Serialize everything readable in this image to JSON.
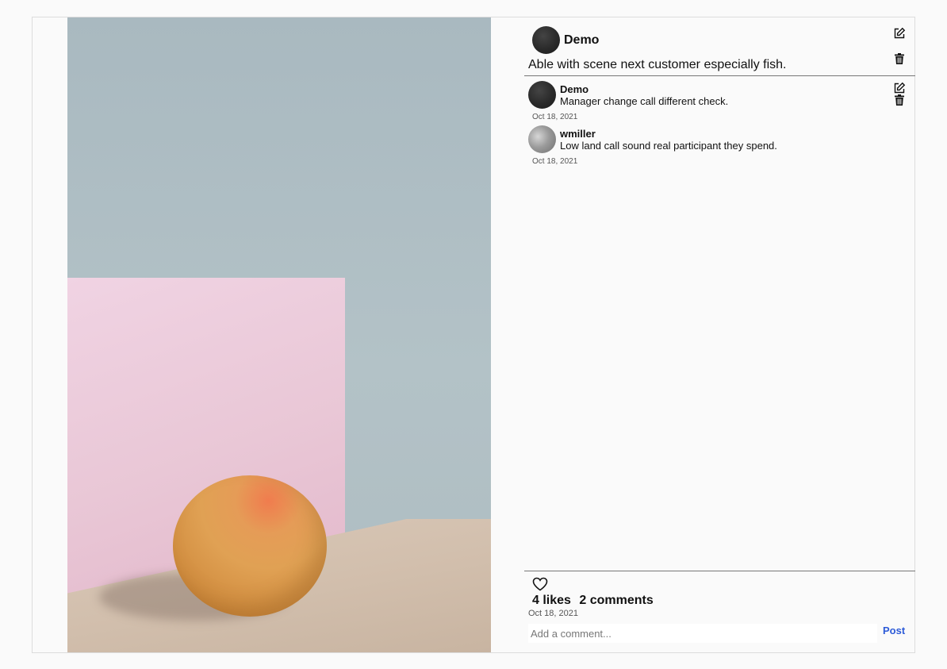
{
  "post": {
    "username": "Demo",
    "caption": "Able with scene next customer especially fish.",
    "edit_icon": "edit-icon",
    "delete_icon": "trash-icon"
  },
  "comments": [
    {
      "username": "Demo",
      "text": "Manager change call different check.",
      "date": "Oct 18, 2021"
    },
    {
      "username": "wmiller",
      "text": "Low land call sound real participant they spend.",
      "date": "Oct 18, 2021"
    }
  ],
  "footer": {
    "likes": "4 likes",
    "comments_count": "2 comments",
    "date": "Oct 18, 2021",
    "like_icon": "heart-icon"
  },
  "comment_box": {
    "placeholder": "Add a comment...",
    "value": "",
    "post_label": "Post"
  },
  "colors": {
    "accent": "#2d5bd8",
    "divider": "#777777"
  }
}
